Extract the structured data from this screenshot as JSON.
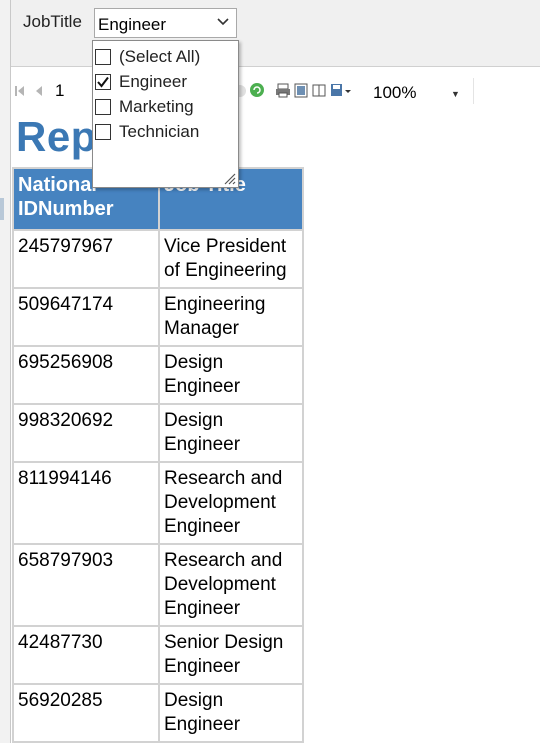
{
  "parameter": {
    "label": "JobTitle",
    "selected_value": "Engineer",
    "options": [
      {
        "label": "(Select All)",
        "checked": false
      },
      {
        "label": "Engineer",
        "checked": true
      },
      {
        "label": "Marketing",
        "checked": false
      },
      {
        "label": "Technician",
        "checked": false
      }
    ]
  },
  "toolbar": {
    "page_number": "1",
    "zoom": "100%"
  },
  "report": {
    "title": "Rep",
    "columns": [
      "National IDNumber",
      "Job Title"
    ],
    "rows": [
      {
        "id": "245797967",
        "title": "Vice President of Engineering"
      },
      {
        "id": "509647174",
        "title": "Engineering Manager"
      },
      {
        "id": "695256908",
        "title": "Design Engineer"
      },
      {
        "id": "998320692",
        "title": "Design Engineer"
      },
      {
        "id": "811994146",
        "title": "Research and Development Engineer"
      },
      {
        "id": "658797903",
        "title": "Research and Development Engineer"
      },
      {
        "id": "42487730",
        "title": "Senior Design Engineer"
      },
      {
        "id": "56920285",
        "title": "Design Engineer"
      }
    ]
  },
  "colors": {
    "header_bg": "#4683c0",
    "title": "#3b78b4"
  }
}
